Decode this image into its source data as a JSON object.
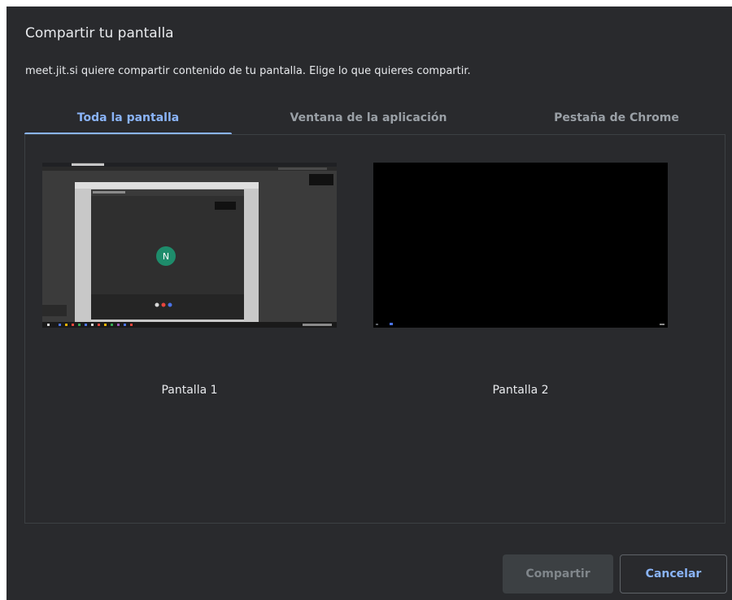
{
  "dialog": {
    "title": "Compartir tu pantalla",
    "subtitle": "meet.jit.si quiere compartir contenido de tu pantalla. Elige lo que quieres compartir."
  },
  "tabs": [
    {
      "label": "Toda la pantalla",
      "active": true
    },
    {
      "label": "Ventana de la aplicación",
      "active": false
    },
    {
      "label": "Pestaña de Chrome",
      "active": false
    }
  ],
  "screens": [
    {
      "label": "Pantalla 1",
      "avatar_initial": "N"
    },
    {
      "label": "Pantalla 2"
    }
  ],
  "buttons": {
    "share": "Compartir",
    "cancel": "Cancelar"
  },
  "colors": {
    "background": "#292a2d",
    "accent": "#8ab4f8",
    "avatar": "#1e8c6b"
  }
}
